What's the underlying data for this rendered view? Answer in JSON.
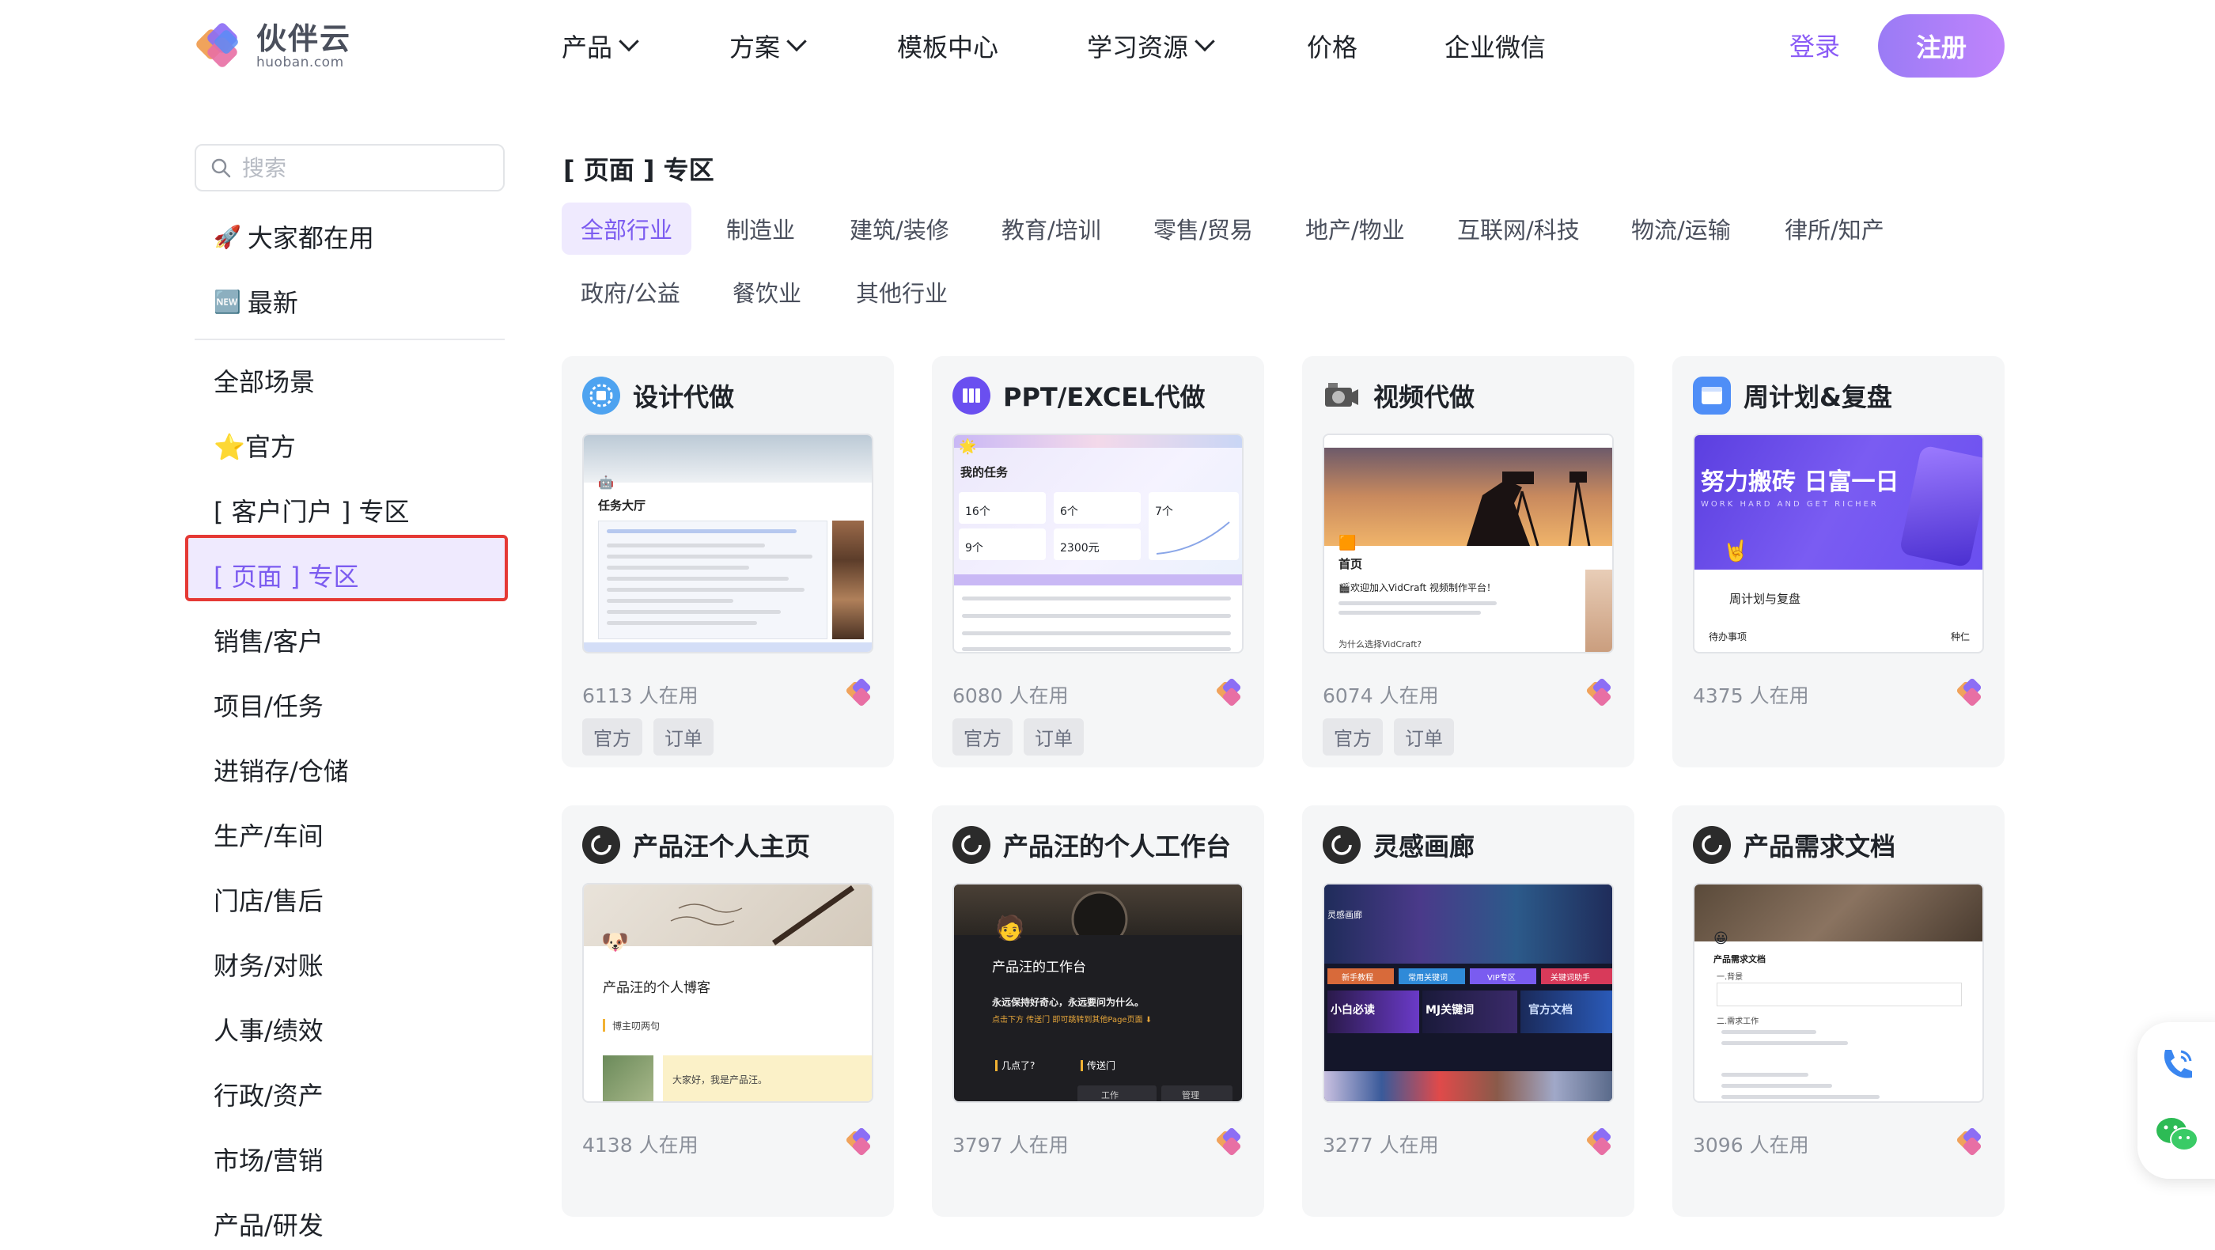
{
  "brand": {
    "name_cn": "伙伴云",
    "name_en": "huoban.com"
  },
  "nav": {
    "items": [
      {
        "label": "产品",
        "dropdown": true
      },
      {
        "label": "方案",
        "dropdown": true
      },
      {
        "label": "模板中心",
        "dropdown": false
      },
      {
        "label": "学习资源",
        "dropdown": true
      },
      {
        "label": "价格",
        "dropdown": false
      },
      {
        "label": "企业微信",
        "dropdown": false
      }
    ],
    "login": "登录",
    "register": "注册"
  },
  "colors": {
    "accent": "#8b5cf6",
    "active_bg": "#efeafe",
    "highlight_border": "#e53935"
  },
  "sidebar": {
    "search_placeholder": "搜索",
    "top_items": [
      {
        "icon": "rocket-icon",
        "emoji": "🚀",
        "label": "大家都在用"
      },
      {
        "icon": "new-badge-icon",
        "emoji": "🆕",
        "label": "最新"
      }
    ],
    "items": [
      {
        "label": "全部场景"
      },
      {
        "label": "⭐官方"
      },
      {
        "label": "[ 客户门户 ] 专区"
      },
      {
        "label": "[ 页面 ] 专区",
        "active": true
      },
      {
        "label": "销售/客户"
      },
      {
        "label": "项目/任务"
      },
      {
        "label": "进销存/仓储"
      },
      {
        "label": "生产/车间"
      },
      {
        "label": "门店/售后"
      },
      {
        "label": "财务/对账"
      },
      {
        "label": "人事/绩效"
      },
      {
        "label": "行政/资产"
      },
      {
        "label": "市场/营销"
      },
      {
        "label": "产品/研发"
      }
    ]
  },
  "main": {
    "title": "[ 页面 ] 专区",
    "industries": [
      "全部行业",
      "制造业",
      "建筑/装修",
      "教育/培训",
      "零售/贸易",
      "地产/物业",
      "互联网/科技",
      "物流/运输",
      "律所/知产",
      "政府/公益",
      "餐饮业",
      "其他行业"
    ],
    "active_industry": "全部行业",
    "cards": [
      {
        "title": "设计代做",
        "users": "6113 人在用",
        "tags": [
          "官方",
          "订单"
        ],
        "icon": "gear-chip-icon"
      },
      {
        "title": "PPT/EXCEL代做",
        "users": "6080 人在用",
        "tags": [
          "官方",
          "订单"
        ],
        "icon": "book-icon"
      },
      {
        "title": "视频代做",
        "users": "6074 人在用",
        "tags": [
          "官方",
          "订单"
        ],
        "icon": "camera-icon"
      },
      {
        "title": "周计划&复盘",
        "users": "4375 人在用",
        "tags": [],
        "icon": "window-icon"
      },
      {
        "title": "产品汪个人主页",
        "users": "4138 人在用",
        "tags": [],
        "icon": "loading-ring-icon"
      },
      {
        "title": "产品汪的个人工作台",
        "users": "3797 人在用",
        "tags": [],
        "icon": "loading-ring-icon"
      },
      {
        "title": "灵感画廊",
        "users": "3277 人在用",
        "tags": [],
        "icon": "loading-ring-icon"
      },
      {
        "title": "产品需求文档",
        "users": "3096 人在用",
        "tags": [],
        "icon": "loading-ring-icon"
      }
    ]
  },
  "thumbs": {
    "t1": {
      "heading": "任务大厅"
    },
    "t2": {
      "heading": "我的任务",
      "stats": [
        "16个",
        "6个",
        "7个",
        "9个",
        "2300元"
      ]
    },
    "t3": {
      "heading": "首页",
      "welcome": "🎬欢迎加入VidCraft 视频制作平台！",
      "q": "为什么选择VidCraft?"
    },
    "t4": {
      "headline": "努力搬砖 日富一日",
      "sub": "WORK HARD AND GET RICHER",
      "label": "周计划与复盘",
      "todo": "待办事项",
      "seed": "种仁"
    },
    "t5": {
      "heading": "产品汪的个人博客",
      "sub": "博主叨两句",
      "note": "大家好，我是产品汪。"
    },
    "t6": {
      "heading": "产品汪的工作台",
      "line1": "永远保持好奇心，永远要问为什么。",
      "line2": "点击下方 传送门 即可跳转到其他Page页面 ⬇",
      "a": "几点了?",
      "b": "传送门",
      "c": "工作",
      "d": "管理"
    },
    "t7": {
      "heading": "灵感画廊",
      "tabs": [
        "新手教程",
        "常用关键词",
        "VIP专区",
        "关键词助手"
      ],
      "t1": "小白必读",
      "t2": "MJ关键词",
      "t3": "官方文档"
    },
    "t8": {
      "heading": "产品需求文档",
      "s1": "一.背景",
      "s2": "二.需求工作"
    }
  }
}
